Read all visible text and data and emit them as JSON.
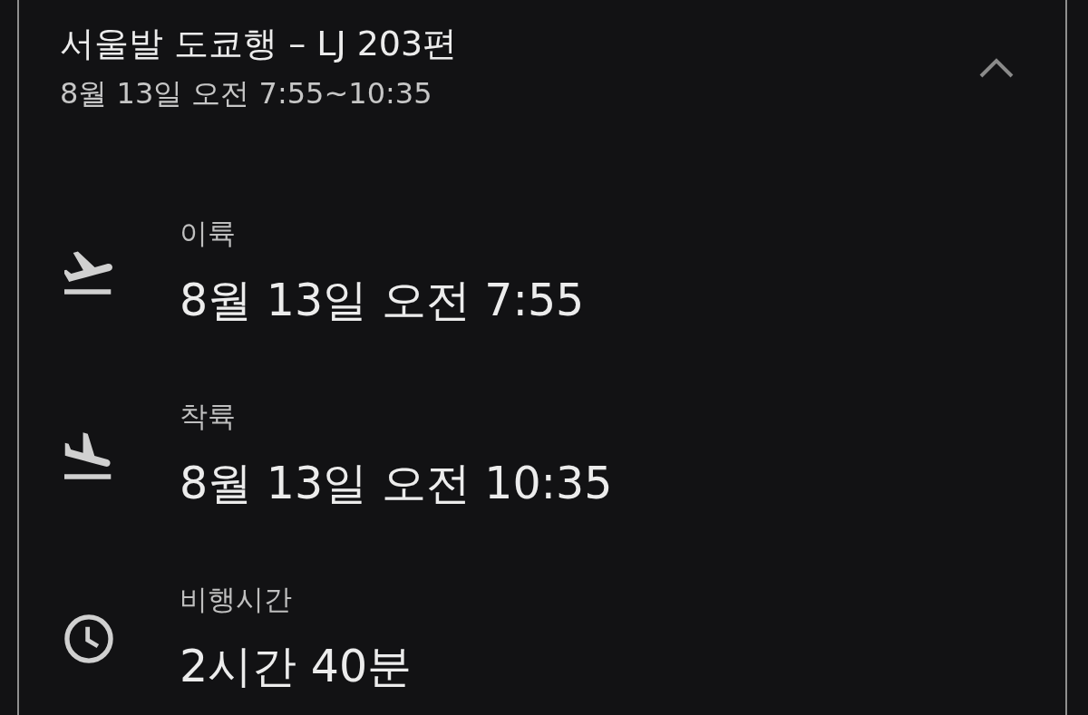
{
  "header": {
    "title": "서울발 도쿄행 – LJ 203편",
    "subtitle": "8월 13일 오전 7:55~10:35",
    "expanded": true
  },
  "details": [
    {
      "kind": "takeoff",
      "label": "이륙",
      "value": "8월 13일 오전 7:55"
    },
    {
      "kind": "landing",
      "label": "착륙",
      "value": "8월 13일 오전 10:35"
    },
    {
      "kind": "duration",
      "label": "비행시간",
      "value": "2시간 40분"
    }
  ]
}
